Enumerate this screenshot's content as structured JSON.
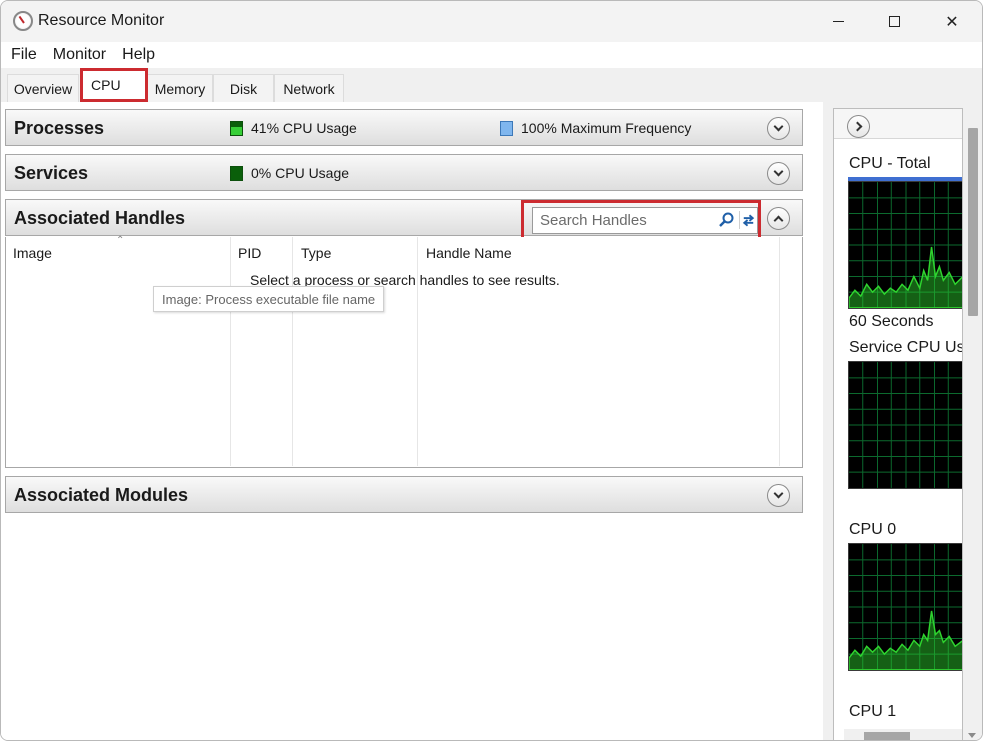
{
  "window": {
    "title": "Resource Monitor"
  },
  "menu": {
    "items": [
      "File",
      "Monitor",
      "Help"
    ]
  },
  "tabs": [
    "Overview",
    "CPU",
    "Memory",
    "Disk",
    "Network"
  ],
  "sections": {
    "processes": {
      "title": "Processes",
      "cpu_usage": "41% CPU Usage",
      "max_frequency": "100% Maximum Frequency"
    },
    "services": {
      "title": "Services",
      "cpu_usage": "0% CPU Usage"
    },
    "handles": {
      "title": "Associated Handles",
      "search_placeholder": "Search Handles",
      "columns": [
        "Image",
        "PID",
        "Type",
        "Handle Name"
      ],
      "empty_message": "Select a process or search handles to see results.",
      "tooltip": "Image: Process executable file name"
    },
    "modules": {
      "title": "Associated Modules"
    }
  },
  "side": {
    "graphs": [
      {
        "label": "CPU - Total",
        "footer": "60 Seconds"
      },
      {
        "label": "Service CPU Us"
      },
      {
        "label": "CPU 0"
      },
      {
        "label": "CPU 1"
      }
    ]
  },
  "colors": {
    "highlight": "#cc2b30",
    "graph_line": "#2fd42f",
    "graph_grid": "#0c6a2e"
  },
  "icons": [
    "app-icon",
    "search-icon",
    "refresh-icon",
    "chevron-down-icon",
    "chevron-up-icon",
    "chevron-right-icon"
  ]
}
